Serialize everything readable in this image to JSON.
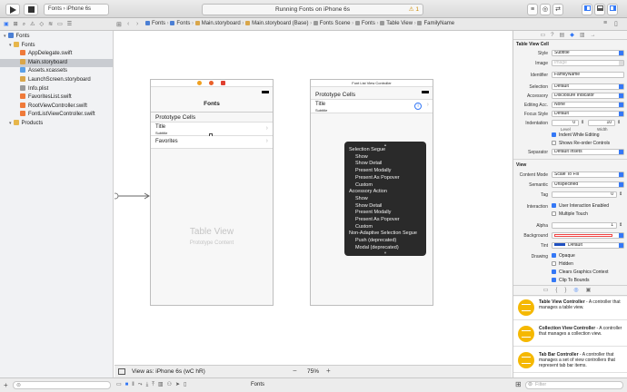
{
  "toolbar": {
    "scheme_app": "Fonts",
    "scheme_device": "iPhone 6s",
    "status": "Running Fonts on iPhone 6s",
    "warning_count": "1"
  },
  "breadcrumb": [
    "Fonts",
    "Fonts",
    "Main.storyboard",
    "Main.storyboard (Base)",
    "Fonts Scene",
    "Fonts",
    "Table View",
    "FamilyName"
  ],
  "navigator": {
    "items": [
      {
        "label": "Fonts",
        "indent": 0,
        "kind": "project",
        "selected": false
      },
      {
        "label": "Fonts",
        "indent": 1,
        "kind": "folder",
        "selected": false
      },
      {
        "label": "AppDelegate.swift",
        "indent": 2,
        "kind": "swift",
        "selected": false
      },
      {
        "label": "Main.storyboard",
        "indent": 2,
        "kind": "storyboard",
        "selected": true
      },
      {
        "label": "Assets.xcassets",
        "indent": 2,
        "kind": "assets",
        "selected": false
      },
      {
        "label": "LaunchScreen.storyboard",
        "indent": 2,
        "kind": "storyboard",
        "selected": false
      },
      {
        "label": "Info.plist",
        "indent": 2,
        "kind": "plist",
        "selected": false
      },
      {
        "label": "FavoritesList.swift",
        "indent": 2,
        "kind": "swift",
        "selected": false
      },
      {
        "label": "RootViewController.swift",
        "indent": 2,
        "kind": "swift",
        "selected": false
      },
      {
        "label": "FontListViewController.swift",
        "indent": 2,
        "kind": "swift",
        "selected": false
      },
      {
        "label": "Products",
        "indent": 1,
        "kind": "folder",
        "selected": false
      }
    ]
  },
  "scene1": {
    "nav_title": "Fonts",
    "section_header": "Prototype Cells",
    "cell1_title": "Title",
    "cell1_subtitle": "Subtitle",
    "cell2_title": "Favorites",
    "table_view_label": "Table View",
    "table_view_sub": "Prototype Content"
  },
  "scene2": {
    "header": "Font List View Controller",
    "section_header": "Prototype Cells",
    "cell_title": "Title",
    "cell_subtitle": "Subtitle"
  },
  "segue_menu": {
    "sections": [
      {
        "header": "Selection Segue",
        "items": [
          "Show",
          "Show Detail",
          "Present Modally",
          "Present As Popover",
          "Custom"
        ]
      },
      {
        "header": "Accessory Action",
        "items": [
          "Show",
          "Show Detail",
          "Present Modally",
          "Present As Popover",
          "Custom"
        ]
      },
      {
        "header": "Non-Adaptive Selection Segue",
        "items": [
          "Push (deprecated)",
          "Modal (deprecated)"
        ]
      }
    ]
  },
  "canvas_bottom": {
    "view_as": "View as: iPhone 6s (wC hR)",
    "zoom": "75%"
  },
  "inspector": {
    "section_cell": "Table View Cell",
    "style_label": "Style",
    "style_value": "Subtitle",
    "image_label": "Image",
    "image_placeholder": "Image",
    "identifier_label": "Identifier",
    "identifier_value": "FamilyName",
    "selection_label": "Selection",
    "selection_value": "Default",
    "accessory_label": "Accessory",
    "accessory_value": "Disclosure Indicator",
    "editing_acc_label": "Editing Acc.",
    "editing_acc_value": "None",
    "focus_style_label": "Focus Style",
    "focus_style_value": "Default",
    "indentation_label": "Indentation",
    "indent_level": "0",
    "indent_width": "10",
    "level_caption": "Level",
    "width_caption": "Width",
    "indent_while_editing": "Indent While Editing",
    "show_reorder": "Shows Re-order Controls",
    "separator_label": "Separator",
    "separator_value": "Default Insets",
    "section_view": "View",
    "content_mode_label": "Content Mode",
    "content_mode_value": "Scale To Fill",
    "semantic_label": "Semantic",
    "semantic_value": "Unspecified",
    "tag_label": "Tag",
    "tag_value": "0",
    "interaction_label": "Interaction",
    "user_interaction": "User Interaction Enabled",
    "multiple_touch": "Multiple Touch",
    "alpha_label": "Alpha",
    "alpha_value": "1",
    "background_label": "Background",
    "tint_label": "Tint",
    "tint_value": "Default",
    "drawing_label": "Drawing",
    "opaque": "Opaque",
    "hidden": "Hidden",
    "clears_graphics": "Clears Graphics Context",
    "clip_to_bounds": "Clip To Bounds"
  },
  "library": [
    {
      "title": "Table View Controller",
      "desc": " - A controller that manages a table view."
    },
    {
      "title": "Collection View Controller",
      "desc": " - A controller that manages a collection view."
    },
    {
      "title": "Tab Bar Controller",
      "desc": " - A controller that manages a set of view controllers that represent tab bar items."
    }
  ],
  "bottom": {
    "filter_placeholder": "Filter",
    "target": "Fonts"
  },
  "colors": {
    "accent": "#3478f6",
    "library_icon": "#f5b800",
    "selection": "#c9ccd1"
  }
}
